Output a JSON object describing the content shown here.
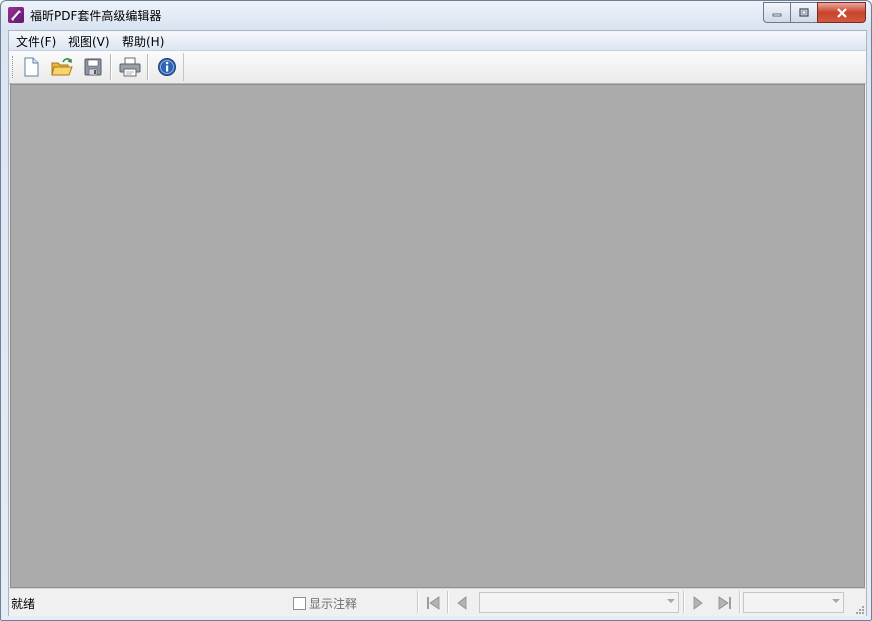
{
  "window": {
    "title": "福昕PDF套件高级编辑器"
  },
  "caption_buttons": {
    "minimize": "minimize-icon",
    "maximize": "maximize-icon",
    "close": "close-icon"
  },
  "menu": {
    "items": [
      {
        "label": "文件(F)"
      },
      {
        "label": "视图(V)"
      },
      {
        "label": "帮助(H)"
      }
    ]
  },
  "toolbar": {
    "buttons": [
      "new-document-icon",
      "open-folder-icon",
      "save-icon",
      "print-icon",
      "info-icon"
    ]
  },
  "status": {
    "text": "就绪",
    "show_annotations_label": "显示注释",
    "show_annotations_checked": false,
    "page_value": "",
    "zoom_value": ""
  },
  "colors": {
    "viewport_bg": "#ababab",
    "close_button": "#c7432c",
    "app_icon": "#7a2480"
  }
}
